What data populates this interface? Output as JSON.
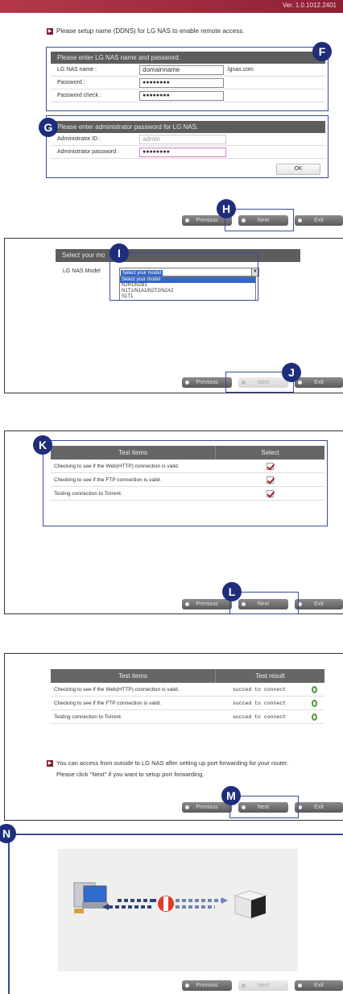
{
  "version": "Ver. 1.0.1012.2401",
  "section1": {
    "instruction": "Please setup name (DDNS) for LG NAS to enable remote access.",
    "panel_f": {
      "header": "Please enter LG NAS name and password.",
      "name_label": "LG NAS name :",
      "name_value": "domainname",
      "domain_suffix": ".lgnas.com",
      "password_label": "Password :",
      "password_value": "●●●●●●●●",
      "password_check_label": "Password check :",
      "password_check_value": "●●●●●●●●"
    },
    "panel_g": {
      "header": "Please enter administrator password for LG NAS.",
      "admin_id_label": "Administrator ID :",
      "admin_id_value": "admin",
      "admin_pw_label": "Administrator password :",
      "admin_pw_value": "●●●●●●●●",
      "ok_label": "OK"
    }
  },
  "markers": {
    "f": "F",
    "g": "G",
    "h": "H",
    "i": "I",
    "j": "J",
    "k": "K",
    "l": "L",
    "m": "M",
    "n": "N"
  },
  "nav": {
    "previous": "Previous",
    "next": "Next",
    "exit": "Exit"
  },
  "section2": {
    "header": "Select your mo",
    "model_label": "LG NAS Model",
    "select_value": "Select your model",
    "options": [
      "Select your model",
      "N2R1/N2B1",
      "N1T1/N1A1/N2T2/N2A2",
      "S1T1"
    ]
  },
  "section3": {
    "col_items": "Test items",
    "col_select": "Select",
    "rows": [
      "Checking to see if the Web(HTTP) connection is valid.",
      "Checking to see if the FTP connection is valid.",
      "Testing connection to Torrent."
    ]
  },
  "section4": {
    "col_items": "Test items",
    "col_result": "Test result",
    "rows": [
      {
        "item": "Checking to see if the Web(HTTP) connection is valid.",
        "result": "succed to connect"
      },
      {
        "item": "Checking to see if the FTP connection is valid.",
        "result": "succed to connect"
      },
      {
        "item": "Testing connection to Torrent.",
        "result": "succed to connect"
      }
    ],
    "message_line1": "You can access from outside to LG NAS after setting up port forwarding for your router.",
    "message_line2": "Please click \"Next\" if you want to setup port forwarding."
  },
  "colors": {
    "accent": "#1f2e7a",
    "brand": "#8e2034",
    "check": "#b01c2c",
    "ok": "#4a9a3a"
  }
}
